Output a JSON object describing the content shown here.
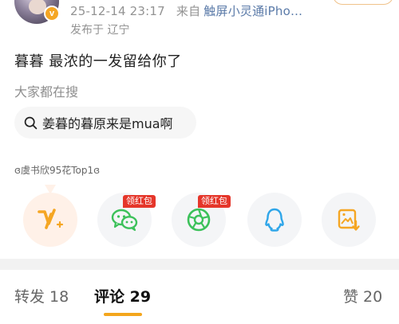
{
  "header": {
    "timestamp": "25-12-14 23:17",
    "from_label": "来自",
    "source": "触屏小灵通iPho…",
    "published": "发布于 辽宁",
    "verify_badge": "v"
  },
  "post": {
    "text": "暮暮 最浓的一发留给你了"
  },
  "search": {
    "caption": "大家都在搜",
    "chip_text": "姜暮的暮原来是mua啊",
    "icon": "search-icon"
  },
  "hashtag": {
    "text": "ɞ虞书欣95花Top1ɞ"
  },
  "share": {
    "items": [
      {
        "icon": "weibo-v-plus-icon",
        "badge": ""
      },
      {
        "icon": "wechat-icon",
        "badge": "领红包"
      },
      {
        "icon": "moments-icon",
        "badge": "领红包"
      },
      {
        "icon": "qq-icon",
        "badge": ""
      },
      {
        "icon": "save-image-icon",
        "badge": ""
      }
    ],
    "colors": {
      "orange": "#f5a623",
      "green": "#3cc15a",
      "blue": "#2fa6e9",
      "red_badge": "#e5362a"
    }
  },
  "tabs": {
    "repost_label": "转发 18",
    "comment_label": "评论 29",
    "like_label": "赞 20",
    "active": "comment",
    "accent": "#f4a61d"
  }
}
